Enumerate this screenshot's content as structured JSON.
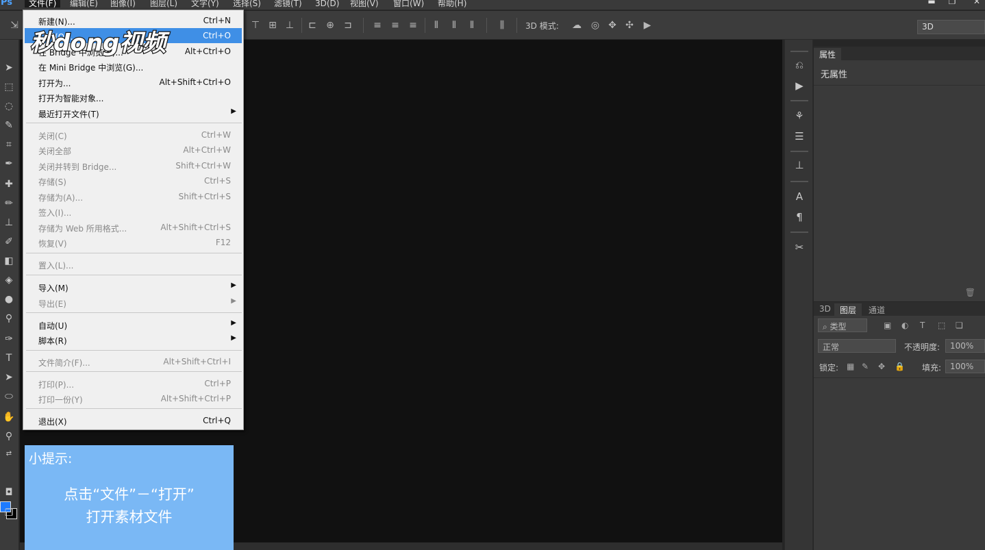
{
  "app": {
    "logo": "Ps"
  },
  "menubar": {
    "items": [
      "文件(F)",
      "编辑(E)",
      "图像(I)",
      "图层(L)",
      "文字(Y)",
      "选择(S)",
      "滤镜(T)",
      "3D(D)",
      "视图(V)",
      "窗口(W)",
      "帮助(H)"
    ]
  },
  "options_bar": {
    "mode_label": "3D 模式:",
    "workspace": "3D"
  },
  "file_menu": {
    "items": [
      {
        "label": "新建(N)...",
        "shortcut": "Ctrl+N",
        "enabled": true
      },
      {
        "label": "打开(O)...",
        "shortcut": "Ctrl+O",
        "enabled": true,
        "highlighted": true
      },
      {
        "label": "在 Bridge 中浏览(B)...",
        "shortcut": "Alt+Ctrl+O",
        "enabled": true
      },
      {
        "label": "在 Mini Bridge 中浏览(G)...",
        "shortcut": "",
        "enabled": true
      },
      {
        "label": "打开为...",
        "shortcut": "Alt+Shift+Ctrl+O",
        "enabled": true
      },
      {
        "label": "打开为智能对象...",
        "shortcut": "",
        "enabled": true
      },
      {
        "label": "最近打开文件(T)",
        "shortcut": "",
        "enabled": true,
        "submenu": true
      },
      {
        "label": "关闭(C)",
        "shortcut": "Ctrl+W",
        "enabled": false
      },
      {
        "label": "关闭全部",
        "shortcut": "Alt+Ctrl+W",
        "enabled": false
      },
      {
        "label": "关闭并转到 Bridge...",
        "shortcut": "Shift+Ctrl+W",
        "enabled": false
      },
      {
        "label": "存储(S)",
        "shortcut": "Ctrl+S",
        "enabled": false
      },
      {
        "label": "存储为(A)...",
        "shortcut": "Shift+Ctrl+S",
        "enabled": false
      },
      {
        "label": "签入(I)...",
        "shortcut": "",
        "enabled": false
      },
      {
        "label": "存储为 Web 所用格式...",
        "shortcut": "Alt+Shift+Ctrl+S",
        "enabled": false
      },
      {
        "label": "恢复(V)",
        "shortcut": "F12",
        "enabled": false
      },
      {
        "label": "置入(L)...",
        "shortcut": "",
        "enabled": false
      },
      {
        "label": "导入(M)",
        "shortcut": "",
        "enabled": true,
        "submenu": true
      },
      {
        "label": "导出(E)",
        "shortcut": "",
        "enabled": false,
        "submenu": true
      },
      {
        "label": "自动(U)",
        "shortcut": "",
        "enabled": true,
        "submenu": true
      },
      {
        "label": "脚本(R)",
        "shortcut": "",
        "enabled": true,
        "submenu": true
      },
      {
        "label": "文件简介(F)...",
        "shortcut": "Alt+Shift+Ctrl+I",
        "enabled": false
      },
      {
        "label": "打印(P)...",
        "shortcut": "Ctrl+P",
        "enabled": false
      },
      {
        "label": "打印一份(Y)",
        "shortcut": "Alt+Shift+Ctrl+P",
        "enabled": false
      },
      {
        "label": "退出(X)",
        "shortcut": "Ctrl+Q",
        "enabled": true
      }
    ]
  },
  "watermark": {
    "text": "秒dong视频"
  },
  "properties_panel": {
    "tab": "属性",
    "content": "无属性"
  },
  "layers_panel": {
    "tabs": [
      "3D",
      "图层",
      "通道"
    ],
    "filter": "类型",
    "blend_mode": "正常",
    "opacity_label": "不透明度:",
    "opacity_value": "100%",
    "lock_label": "锁定:",
    "fill_label": "填充:",
    "fill_value": "100%"
  },
  "tip": {
    "title": "小提示:",
    "line1": "点击“文件”－“打开”",
    "line2": "打开素材文件"
  },
  "colors": {
    "foreground": "#1e7bff",
    "background": "#000000",
    "highlight": "#3f8fe6",
    "tip_bg": "#7ab8f5"
  }
}
